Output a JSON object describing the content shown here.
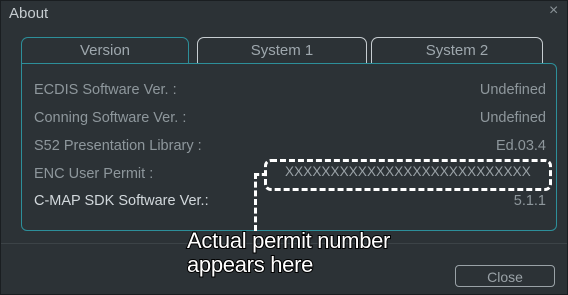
{
  "window": {
    "title": "About",
    "close_glyph": "×"
  },
  "tabs": [
    {
      "label": "Version"
    },
    {
      "label": "System 1"
    },
    {
      "label": "System 2"
    }
  ],
  "rows": [
    {
      "label": "ECDIS Software Ver. :",
      "value": "Undefined"
    },
    {
      "label": "Conning Software Ver. :",
      "value": "Undefined"
    },
    {
      "label": "S52 Presentation Library :",
      "value": "Ed.03.4"
    },
    {
      "label": "ENC User Permit :",
      "value": "XXXXXXXXXXXXXXXXXXXXXXXXXXX"
    },
    {
      "label": "C-MAP SDK Software Ver.:",
      "value": "5.1.1"
    }
  ],
  "callout": {
    "line1": "Actual permit number",
    "line2": "appears here"
  },
  "footer": {
    "close_label": "Close"
  }
}
